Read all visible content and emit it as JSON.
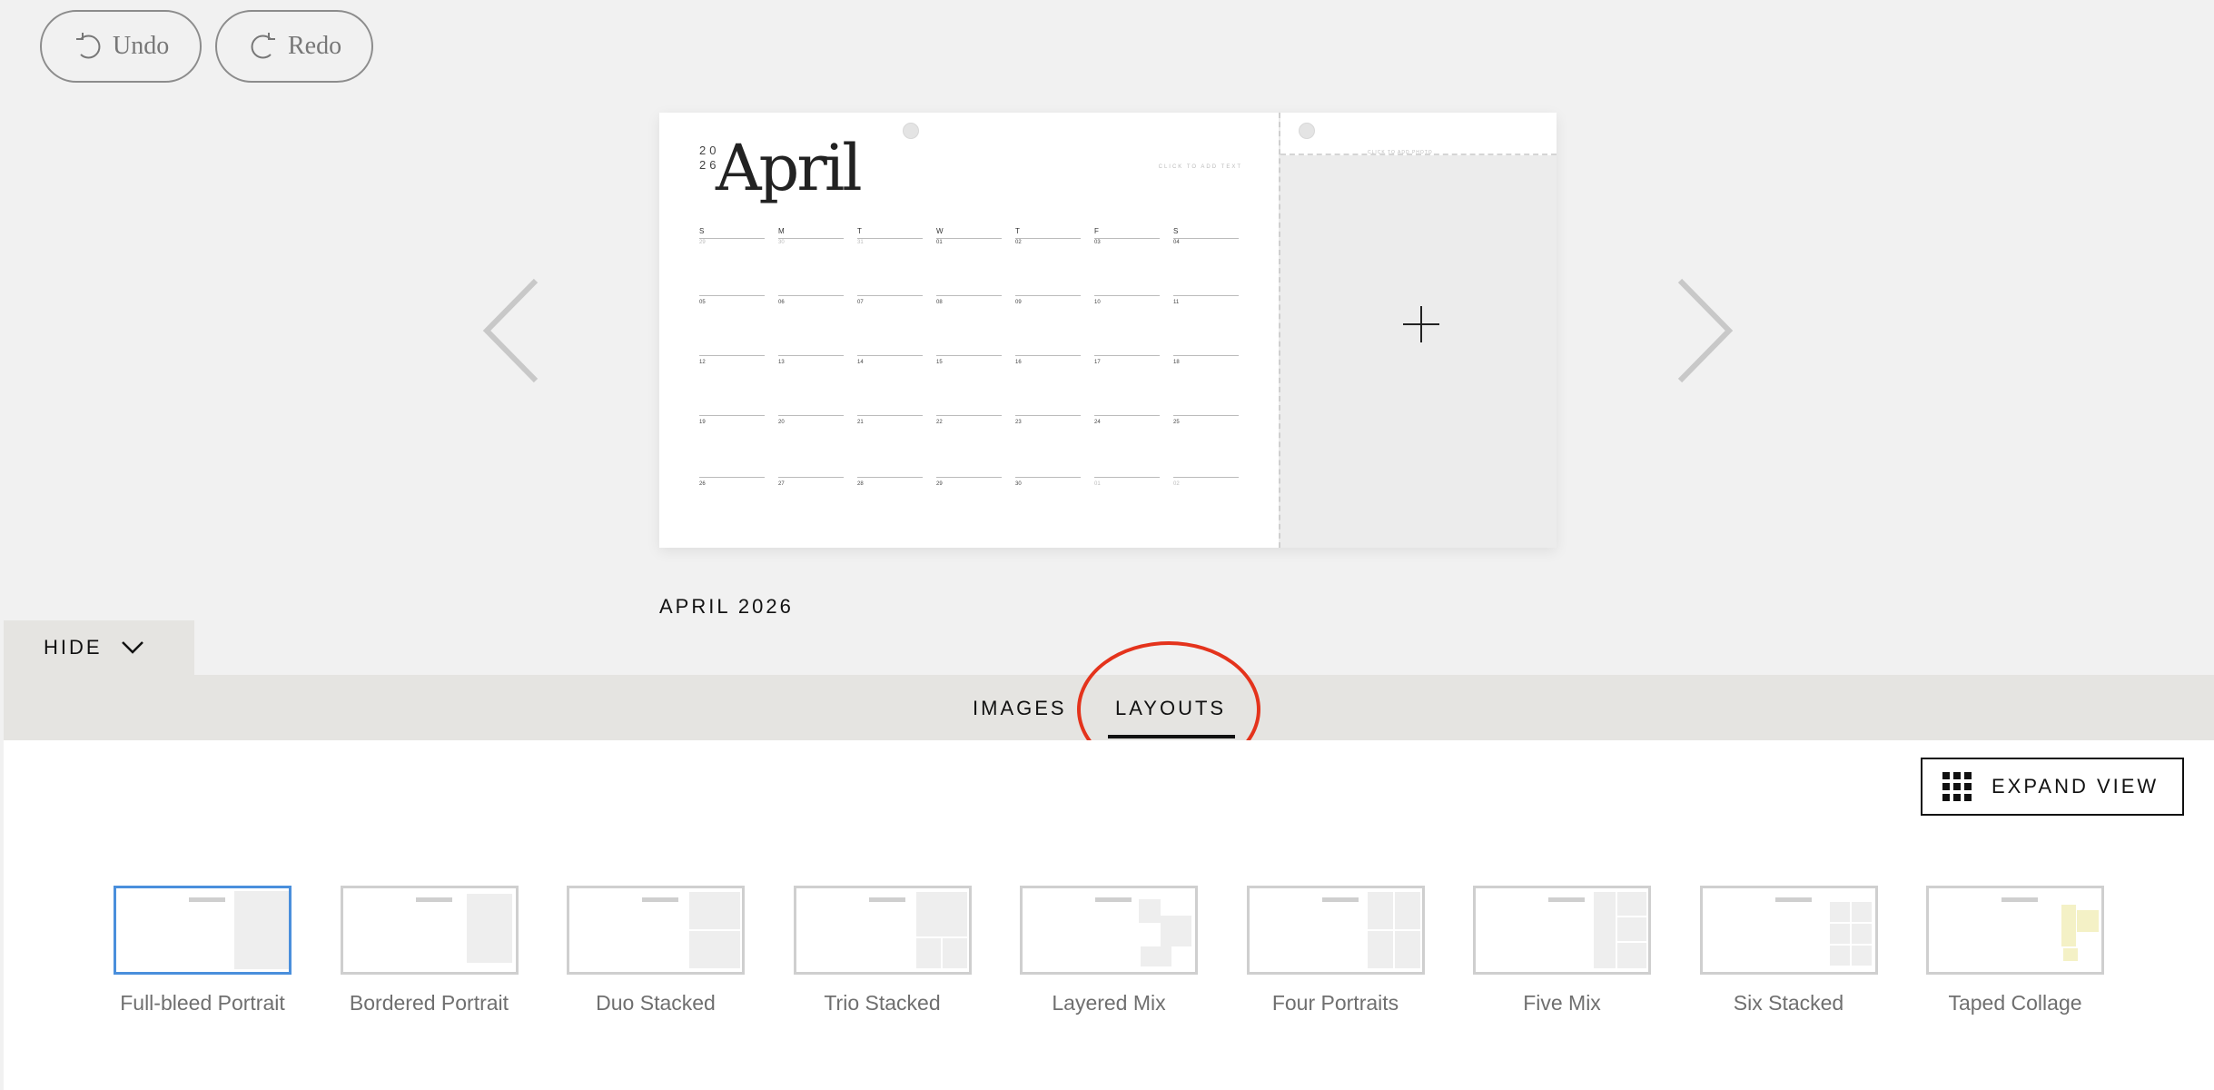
{
  "toolbar": {
    "undo_label": "Undo",
    "redo_label": "Redo"
  },
  "calendar": {
    "year_top": "20",
    "year_bottom": "26",
    "month": "April",
    "click_to_add_text": "CLICK TO ADD TEXT",
    "right_page_hint": "CLICK TO ADD PHOTO",
    "weekdays": [
      "S",
      "M",
      "T",
      "W",
      "T",
      "F",
      "S"
    ],
    "weeks": [
      [
        "29",
        "30",
        "31",
        "01",
        "02",
        "03",
        "04"
      ],
      [
        "05",
        "06",
        "07",
        "08",
        "09",
        "10",
        "11"
      ],
      [
        "12",
        "13",
        "14",
        "15",
        "16",
        "17",
        "18"
      ],
      [
        "19",
        "20",
        "21",
        "22",
        "23",
        "24",
        "25"
      ],
      [
        "26",
        "27",
        "28",
        "29",
        "30",
        "01",
        "02"
      ]
    ],
    "caption": "APRIL 2026"
  },
  "hide_label": "HIDE",
  "tabs": {
    "images": "IMAGES",
    "layouts": "LAYOUTS",
    "active": "LAYOUTS"
  },
  "expand_view_label": "EXPAND VIEW",
  "layouts": [
    {
      "label": "Full-bleed Portrait",
      "selected": true
    },
    {
      "label": "Bordered Portrait"
    },
    {
      "label": "Duo Stacked"
    },
    {
      "label": "Trio Stacked"
    },
    {
      "label": "Layered Mix"
    },
    {
      "label": "Four Portraits"
    },
    {
      "label": "Five Mix"
    },
    {
      "label": "Six Stacked"
    },
    {
      "label": "Taped Collage"
    }
  ],
  "colors": {
    "accent_selected": "#4a8fdc",
    "annotation": "#e4331c",
    "tab_bar": "#e5e4e1"
  },
  "icons": [
    "undo-icon",
    "redo-icon",
    "chevron-left-icon",
    "chevron-right-icon",
    "plus-icon",
    "chevron-down-icon",
    "grid-icon"
  ]
}
